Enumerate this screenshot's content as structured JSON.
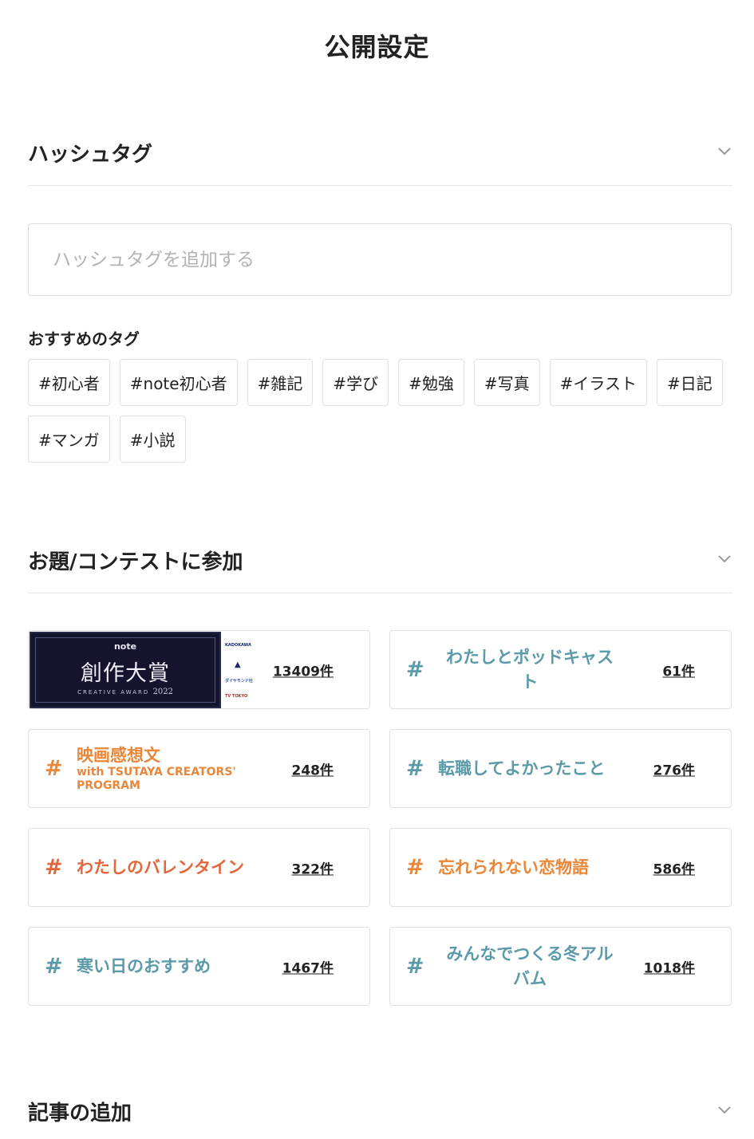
{
  "page": {
    "title": "公開設定"
  },
  "hashtag_section": {
    "title": "ハッシュタグ",
    "input_placeholder": "ハッシュタグを追加する",
    "recommended_label": "おすすめのタグ",
    "tags": [
      "#初心者",
      "#note初心者",
      "#雑記",
      "#学び",
      "#勉強",
      "#写真",
      "#イラスト",
      "#日記",
      "#マンガ",
      "#小説"
    ]
  },
  "contest_section": {
    "title": "お題/コンテストに参加",
    "banner": {
      "brand": "note",
      "title": "創作大賞",
      "subtitle": "CREATIVE AWARD",
      "year": "2022",
      "sponsors": [
        "KADOKAWA",
        "ダイヤモンド社",
        "TV TOKYO"
      ]
    },
    "items": [
      {
        "hash": "#",
        "title": "",
        "subtitle": "",
        "count": "13409件",
        "color": "#222222",
        "is_banner": true
      },
      {
        "hash": "#",
        "title": "わたしとポッドキャスト",
        "subtitle": "",
        "count": "61件",
        "color": "#5b9aa8"
      },
      {
        "hash": "#",
        "title": "映画感想文",
        "subtitle": "with TSUTAYA CREATORS' PROGRAM",
        "count": "248件",
        "color": "#e8873a"
      },
      {
        "hash": "#",
        "title": "転職してよかったこと",
        "subtitle": "",
        "count": "276件",
        "color": "#5b9aa8"
      },
      {
        "hash": "#",
        "title": "わたしのバレンタイン",
        "subtitle": "",
        "count": "322件",
        "color": "#e3663c"
      },
      {
        "hash": "#",
        "title": "忘れられない恋物語",
        "subtitle": "",
        "count": "586件",
        "color": "#e8873a"
      },
      {
        "hash": "#",
        "title": "寒い日のおすすめ",
        "subtitle": "",
        "count": "1467件",
        "color": "#5b9aa8"
      },
      {
        "hash": "#",
        "title": "みんなでつくる冬アルバム",
        "subtitle": "",
        "count": "1018件",
        "color": "#5b9aa8"
      }
    ]
  },
  "article_section": {
    "title": "記事の追加"
  },
  "icons": {
    "collapse": "chevron-down-icon"
  }
}
